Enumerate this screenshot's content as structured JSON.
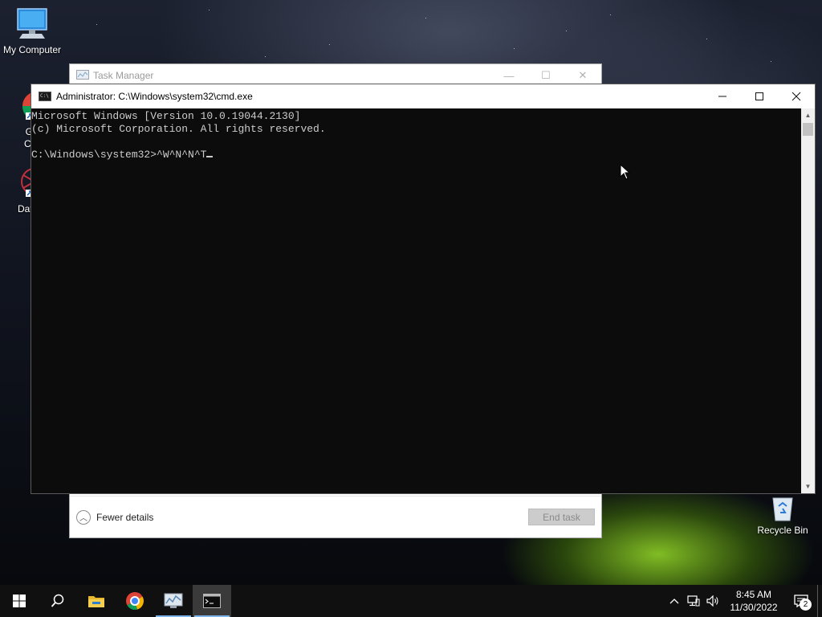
{
  "desktop": {
    "icons": [
      {
        "label": "My Computer",
        "icon": "computer-icon"
      },
      {
        "label": "Goo Chro",
        "icon": "chrome-shortcut-icon"
      },
      {
        "label": "DataW",
        "icon": "datawrangler-shortcut-icon"
      },
      {
        "label": "Recycle Bin",
        "icon": "recycle-bin-icon"
      }
    ]
  },
  "task_manager": {
    "title": "Task Manager",
    "fewer_details_label": "Fewer details",
    "end_task_label": "End task"
  },
  "cmd": {
    "title": "Administrator: C:\\Windows\\system32\\cmd.exe",
    "lines": [
      "Microsoft Windows [Version 10.0.19044.2130]",
      "(c) Microsoft Corporation. All rights reserved.",
      "",
      "C:\\Windows\\system32>^W^N^N^T"
    ]
  },
  "taskbar": {
    "items": [
      "start-icon",
      "search-icon",
      "file-explorer-icon",
      "chrome-icon",
      "task-manager-icon",
      "cmd-icon"
    ],
    "active_item": "cmd-icon",
    "tray": {
      "time": "8:45 AM",
      "date": "11/30/2022",
      "notification_count": "2"
    }
  },
  "colors": {
    "console_bg": "#0c0c0c",
    "console_text": "#cccccc",
    "taskbar_bg": "#101010",
    "active_underline": "#7eb4ea"
  }
}
